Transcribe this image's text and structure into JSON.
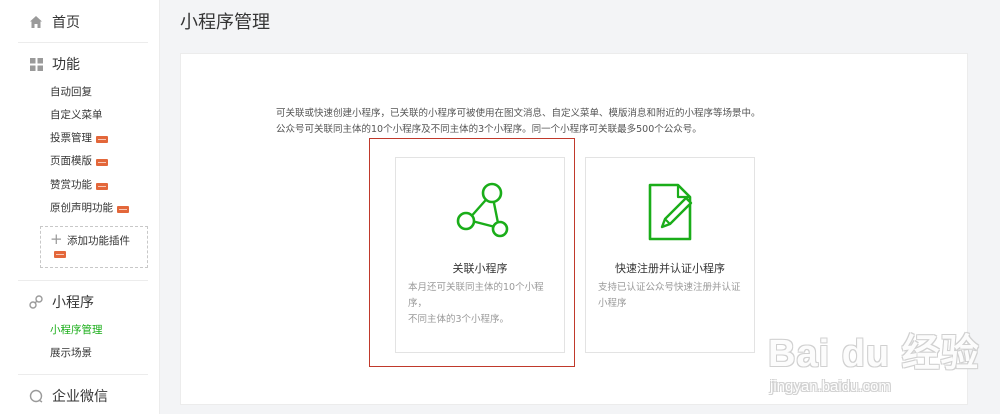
{
  "sidebar": {
    "home": {
      "label": "首页",
      "icon": "home-icon"
    },
    "features": {
      "label": "功能",
      "icon": "grid-icon",
      "items": [
        {
          "label": "自动回复",
          "new": false
        },
        {
          "label": "自定义菜单",
          "new": false
        },
        {
          "label": "投票管理",
          "new": true
        },
        {
          "label": "页面模版",
          "new": true
        },
        {
          "label": "赞赏功能",
          "new": true
        },
        {
          "label": "原创声明功能",
          "new": true
        }
      ],
      "add_plugin": {
        "label": "添加功能插件",
        "new": true
      }
    },
    "mini_program": {
      "label": "小程序",
      "icon": "link-icon",
      "items": [
        {
          "label": "小程序管理",
          "active": true
        },
        {
          "label": "展示场景",
          "active": false
        }
      ]
    },
    "wework": {
      "label": "企业微信",
      "icon": "chat-bubble-icon"
    }
  },
  "main": {
    "title": "小程序管理",
    "description": [
      "可关联或快速创建小程序，已关联的小程序可被使用在图文消息、自定义菜单、模版消息和附近的小程序等场景中。",
      "公众号可关联同主体的10个小程序及不同主体的3个小程序。同一个小程序可关联最多500个公众号。"
    ],
    "cards": [
      {
        "title": "关联小程序",
        "desc_lines": [
          "本月还可关联同主体的10个小程序，",
          "不同主体的3个小程序。"
        ],
        "icon": "share-nodes-icon"
      },
      {
        "title": "快速注册并认证小程序",
        "desc_lines": [
          "支持已认证公众号快速注册并认证",
          "小程序"
        ],
        "icon": "document-pen-icon"
      }
    ]
  },
  "watermark": {
    "brand": "Bai du 经验",
    "url": "jingyan.baidu.com"
  },
  "colors": {
    "accent": "#1aad19",
    "highlight": "#c0392b",
    "badge": "#e3673a"
  }
}
